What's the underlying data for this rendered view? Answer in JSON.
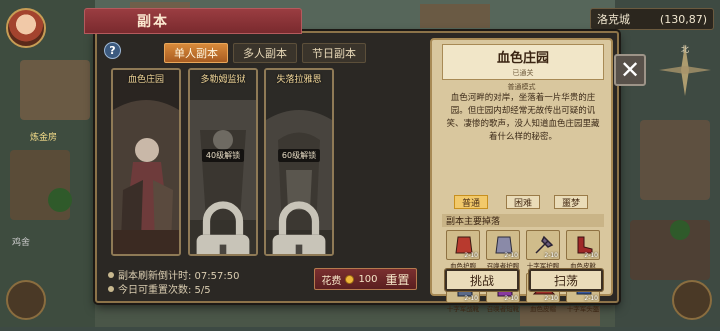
{
  "world": {
    "city_name": "洛克城",
    "coords": "(130,87)",
    "map_label_top": "炼金房",
    "map_label_bottom": "鸡舍",
    "compass_north": "北"
  },
  "dialog": {
    "title": "副本",
    "help_label": "?",
    "tabs": [
      {
        "label": "单人副本",
        "active": true
      },
      {
        "label": "多人副本",
        "active": false
      },
      {
        "label": "节日副本",
        "active": false
      }
    ],
    "dungeons": [
      {
        "name": "血色庄园",
        "locked": false,
        "lock_text": ""
      },
      {
        "name": "多勒姆监狱",
        "locked": true,
        "lock_text": "40级解锁"
      },
      {
        "name": "失落拉雅恩",
        "locked": true,
        "lock_text": "60级解锁"
      }
    ],
    "refresh_label": "副本刷新倒计时: 07:57:50",
    "reset_count_label": "今日可重置次数: 5/5",
    "reset_button": {
      "cost_label": "花费",
      "cost_value": "100",
      "label": "重置"
    },
    "close_label": "✕"
  },
  "detail": {
    "title": "血色庄园",
    "status": "已通关",
    "mode": "普通模式",
    "description": "血色河畔的对岸，坐落着一片华贵的庄园。但庄园内却经常无故传出可疑的讥笑、凄惨的歌声，没人知道血色庄园里藏着什么样的秘密。",
    "difficulties": [
      {
        "label": "普通",
        "active": true
      },
      {
        "label": "困难",
        "active": false
      },
      {
        "label": "噩梦",
        "active": false
      }
    ],
    "drops_header": "副本主要掉落",
    "drops": [
      {
        "name": "血色护腕",
        "qty": "2-10",
        "icon": "bracer-icon",
        "color": "#b83a2e"
      },
      {
        "name": "召唤者护腕",
        "qty": "2-10",
        "icon": "bracer-icon",
        "color": "#8a8aa8"
      },
      {
        "name": "十字军护腕",
        "qty": "2-10",
        "icon": "axe-icon",
        "color": "#6b5c7e"
      },
      {
        "name": "血色皮靴",
        "qty": "2-10",
        "icon": "boots-icon",
        "color": "#a02828"
      },
      {
        "name": "十字军战靴",
        "qty": "2-10",
        "icon": "boots-icon",
        "color": "#5a6a8a"
      },
      {
        "name": "召唤者短靴",
        "qty": "2-10",
        "icon": "boots-icon",
        "color": "#8a3aa0"
      },
      {
        "name": "血色皮帽",
        "qty": "2-10",
        "icon": "hat-icon",
        "color": "#a0302a"
      },
      {
        "name": "十字军头盔",
        "qty": "2-10",
        "icon": "helmet-icon",
        "color": "#3a5aa0"
      }
    ],
    "challenge_label": "挑战",
    "sweep_label": "扫荡"
  }
}
